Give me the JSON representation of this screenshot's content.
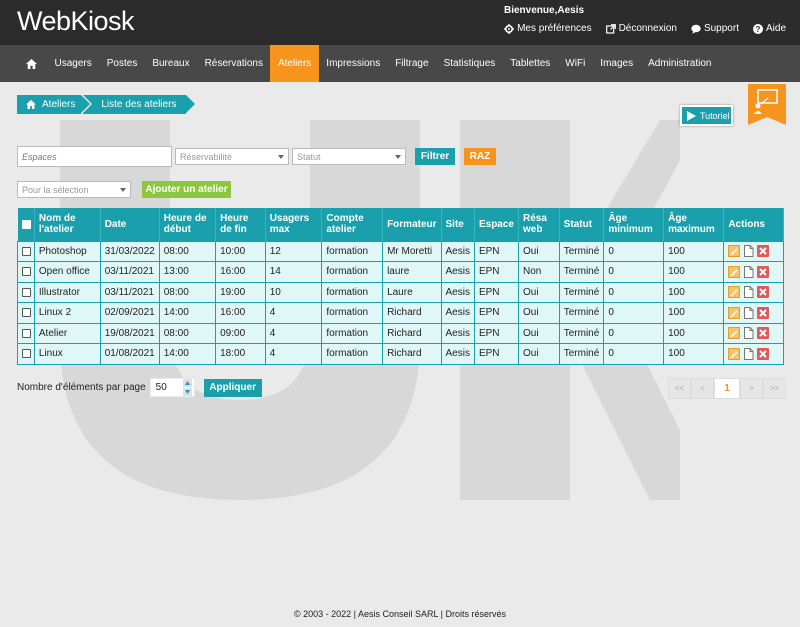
{
  "header": {
    "logo": "WebKiosk",
    "welcome": "Bienvenue,Aesis",
    "links": [
      {
        "label": "Mes préférences",
        "icon": "gear-icon"
      },
      {
        "label": "Déconnexion",
        "icon": "external-link-icon"
      },
      {
        "label": "Support",
        "icon": "chat-icon"
      },
      {
        "label": "Aide",
        "icon": "help-icon"
      }
    ]
  },
  "nav": {
    "items": [
      "Usagers",
      "Postes",
      "Bureaux",
      "Réservations",
      "Ateliers",
      "Impressions",
      "Filtrage",
      "Statistiques",
      "Tablettes",
      "WiFi",
      "Images",
      "Administration"
    ],
    "active": "Ateliers"
  },
  "breadcrumb": {
    "root": "Ateliers",
    "current": "Liste des ateliers"
  },
  "tutoriel": "Tutoriel",
  "filters": {
    "espaces_placeholder": "Espaces",
    "reservabilite": "Réservabilité",
    "statut": "Statut",
    "filtrer": "Filtrer",
    "raz": "RAZ"
  },
  "selection": {
    "placeholder": "Pour la sélection",
    "add": "Ajouter un atelier"
  },
  "table": {
    "headers": [
      "Nom de l'atelier",
      "Date",
      "Heure de début",
      "Heure de fin",
      "Usagers max",
      "Compte atelier",
      "Formateur",
      "Site",
      "Espace",
      "Résa web",
      "Statut",
      "Âge minimum",
      "Âge maximum",
      "Actions"
    ],
    "rows": [
      [
        "Photoshop",
        "31/03/2022",
        "08:00",
        "10:00",
        "12",
        "formation",
        "Mr Moretti",
        "Aesis",
        "EPN",
        "Oui",
        "Terminé",
        "0",
        "100"
      ],
      [
        "Open office",
        "03/11/2021",
        "13:00",
        "16:00",
        "14",
        "formation",
        "laure",
        "Aesis",
        "EPN",
        "Non",
        "Terminé",
        "0",
        "100"
      ],
      [
        "Illustrator",
        "03/11/2021",
        "08:00",
        "19:00",
        "10",
        "formation",
        "Laure",
        "Aesis",
        "EPN",
        "Oui",
        "Terminé",
        "0",
        "100"
      ],
      [
        "Linux 2",
        "02/09/2021",
        "14:00",
        "16:00",
        "4",
        "formation",
        "Richard",
        "Aesis",
        "EPN",
        "Oui",
        "Terminé",
        "0",
        "100"
      ],
      [
        "Atelier",
        "19/08/2021",
        "08:00",
        "09:00",
        "4",
        "formation",
        "Richard",
        "Aesis",
        "EPN",
        "Oui",
        "Terminé",
        "0",
        "100"
      ],
      [
        "Linux",
        "01/08/2021",
        "14:00",
        "18:00",
        "4",
        "formation",
        "Richard",
        "Aesis",
        "EPN",
        "Oui",
        "Terminé",
        "0",
        "100"
      ]
    ]
  },
  "pagination": {
    "per_page_label": "Nombre d'éléments par page",
    "per_page_value": "50",
    "apply": "Appliquer",
    "first": "<<",
    "prev": "<",
    "current": "1",
    "next": ">",
    "last": ">>"
  },
  "footer": "© 2003 - 2022 | Aesis Conseil SARL | Droits réservés",
  "colors": {
    "teal": "#1aa0ad",
    "orange": "#f7941d",
    "green": "#8dc63f",
    "dark": "#2b2b2b"
  }
}
